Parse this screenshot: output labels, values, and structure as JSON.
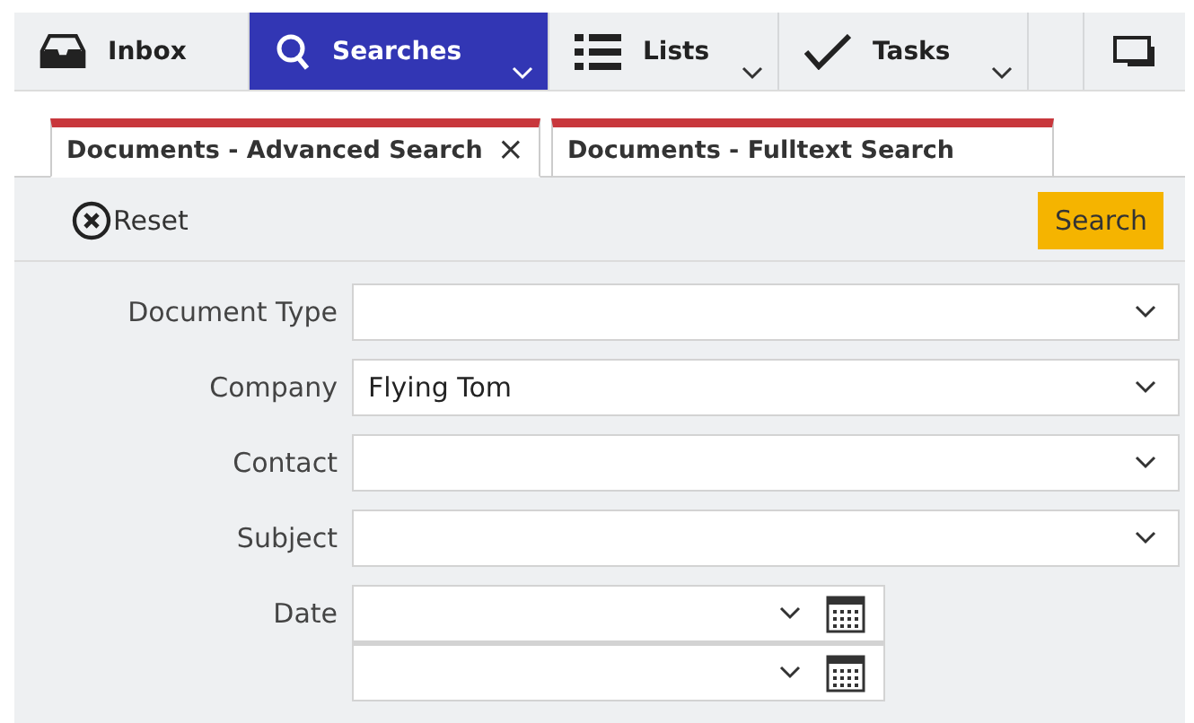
{
  "nav": [
    {
      "kind": "inbox",
      "label": "Inbox",
      "selected": false,
      "has_menu": false
    },
    {
      "kind": "search",
      "label": "Searches",
      "selected": true,
      "has_menu": true
    },
    {
      "kind": "list",
      "label": "Lists",
      "selected": false,
      "has_menu": true
    },
    {
      "kind": "check",
      "label": "Tasks",
      "selected": false,
      "has_menu": true
    }
  ],
  "tabs": [
    {
      "label": "Documents - Advanced Search",
      "selected": true,
      "close": "×"
    },
    {
      "label": "Documents - Fulltext Search",
      "selected": false
    }
  ],
  "toolbar": {
    "reset": "Reset",
    "search": "Search"
  },
  "fields": [
    {
      "kind": "select",
      "label": "Document Type"
    },
    {
      "kind": "select",
      "label": "Company",
      "value": "Flying Tom"
    },
    {
      "kind": "select",
      "label": "Contact"
    },
    {
      "kind": "select",
      "label": "Subject"
    },
    {
      "kind": "daterange",
      "label": "Date"
    }
  ]
}
